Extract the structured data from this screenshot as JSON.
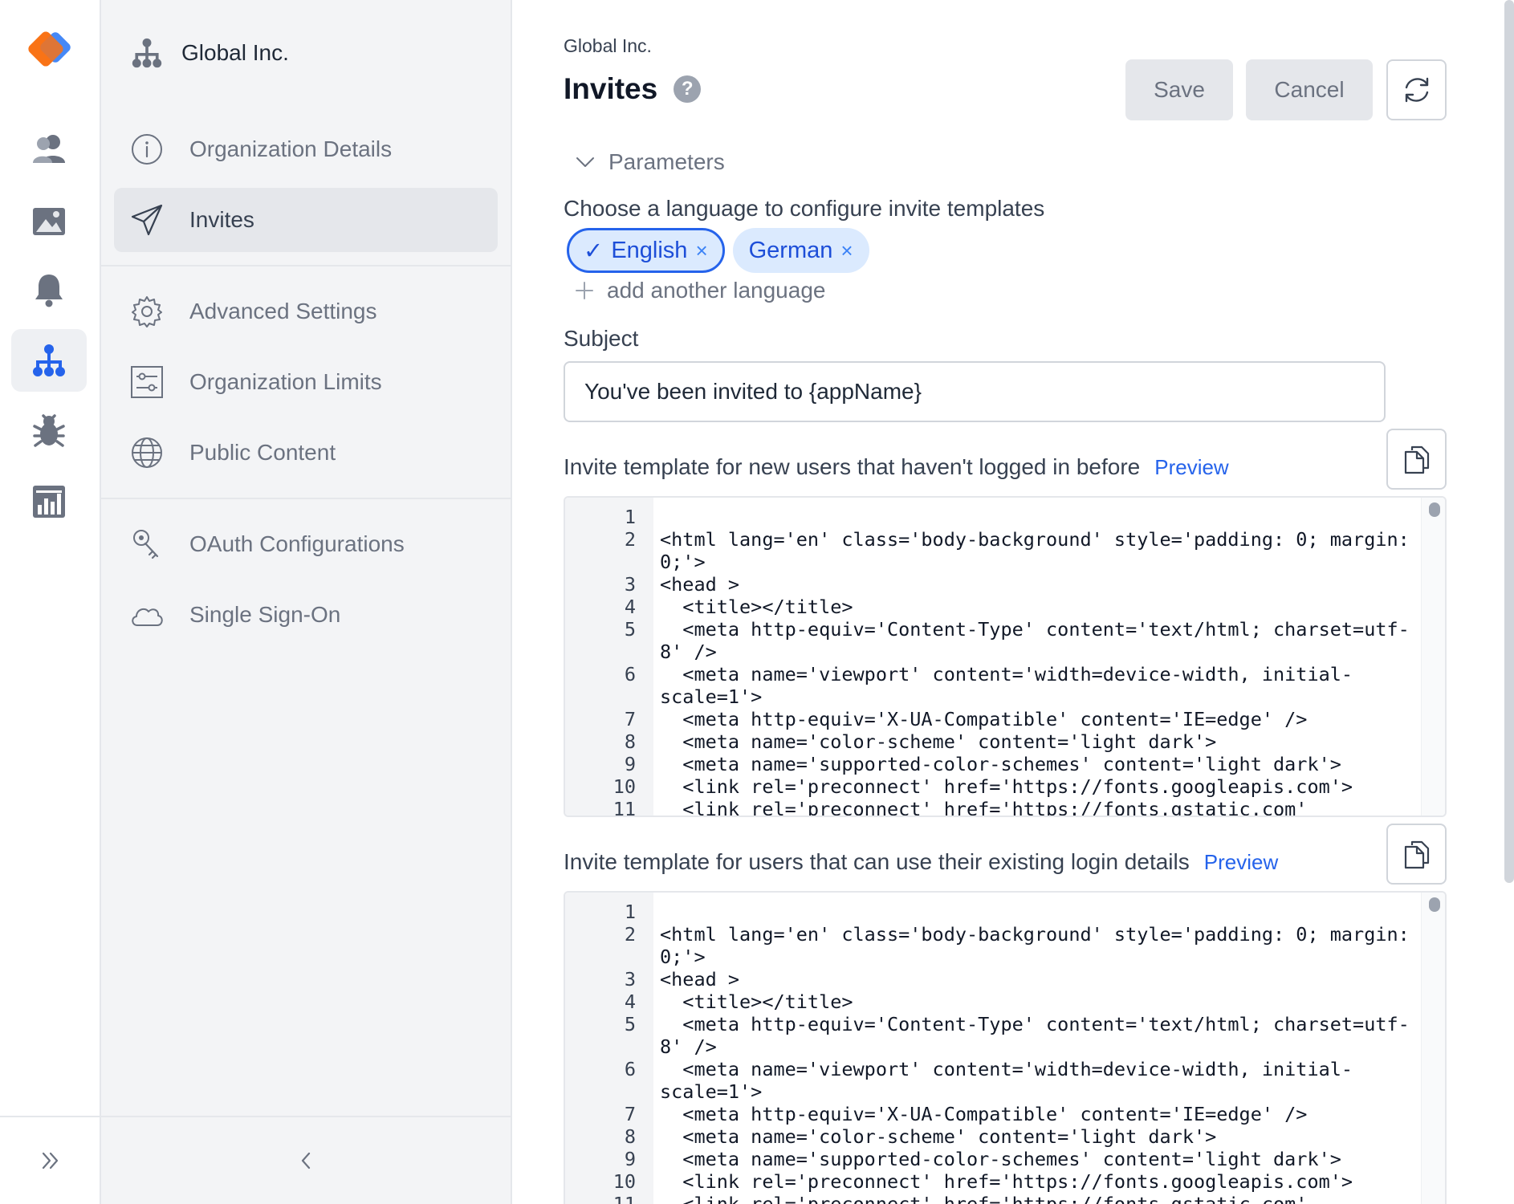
{
  "nav": {
    "org_name": "Global Inc.",
    "items": [
      {
        "label": "Organization Details",
        "icon": "info-circle-icon"
      },
      {
        "label": "Invites",
        "icon": "paper-plane-icon"
      },
      {
        "label": "Advanced Settings",
        "icon": "gear-icon"
      },
      {
        "label": "Organization Limits",
        "icon": "sliders-icon"
      },
      {
        "label": "Public Content",
        "icon": "globe-icon"
      },
      {
        "label": "OAuth Configurations",
        "icon": "key-icon"
      },
      {
        "label": "Single Sign-On",
        "icon": "cloud-icon"
      }
    ]
  },
  "rail": {
    "icons": [
      "users-icon",
      "image-icon",
      "bell-icon",
      "org-tree-icon",
      "bug-icon",
      "chart-icon"
    ],
    "accent": "#2563eb"
  },
  "header": {
    "breadcrumb": "Global Inc.",
    "title": "Invites",
    "help": "?",
    "save_label": "Save",
    "cancel_label": "Cancel"
  },
  "parameters": {
    "toggle_label": "Parameters",
    "language_prompt": "Choose a language to configure invite templates",
    "languages": [
      {
        "label": "English",
        "selected": true
      },
      {
        "label": "German",
        "selected": false
      }
    ],
    "remove_symbol": "×",
    "check_symbol": "✓",
    "add_language": "add another language"
  },
  "subject": {
    "label": "Subject",
    "value": "You've been invited to {appName}"
  },
  "templates": [
    {
      "label": "Invite template for new users that haven't logged in before",
      "preview": "Preview"
    },
    {
      "label": "Invite template for users that can use their existing login details",
      "preview": "Preview"
    }
  ],
  "code_lines": [
    {
      "n": "1",
      "text": ""
    },
    {
      "n": "2",
      "text": "<html lang='en' class='body-background' style='padding: 0; margin: 0;'>"
    },
    {
      "n": "3",
      "text": "<head >"
    },
    {
      "n": "4",
      "text": "  <title></title>"
    },
    {
      "n": "5",
      "text": "  <meta http-equiv='Content-Type' content='text/html; charset=utf-8' />"
    },
    {
      "n": "6",
      "text": "  <meta name='viewport' content='width=device-width, initial-scale=1'>"
    },
    {
      "n": "7",
      "text": "  <meta http-equiv='X-UA-Compatible' content='IE=edge' />"
    },
    {
      "n": "8",
      "text": "  <meta name='color-scheme' content='light dark'>"
    },
    {
      "n": "9",
      "text": "  <meta name='supported-color-schemes' content='light dark'>"
    },
    {
      "n": "10",
      "text": "  <link rel='preconnect' href='https://fonts.googleapis.com'>"
    },
    {
      "n": "11",
      "text": "  <link rel='preconnect' href='https://fonts.gstatic.com'"
    }
  ]
}
